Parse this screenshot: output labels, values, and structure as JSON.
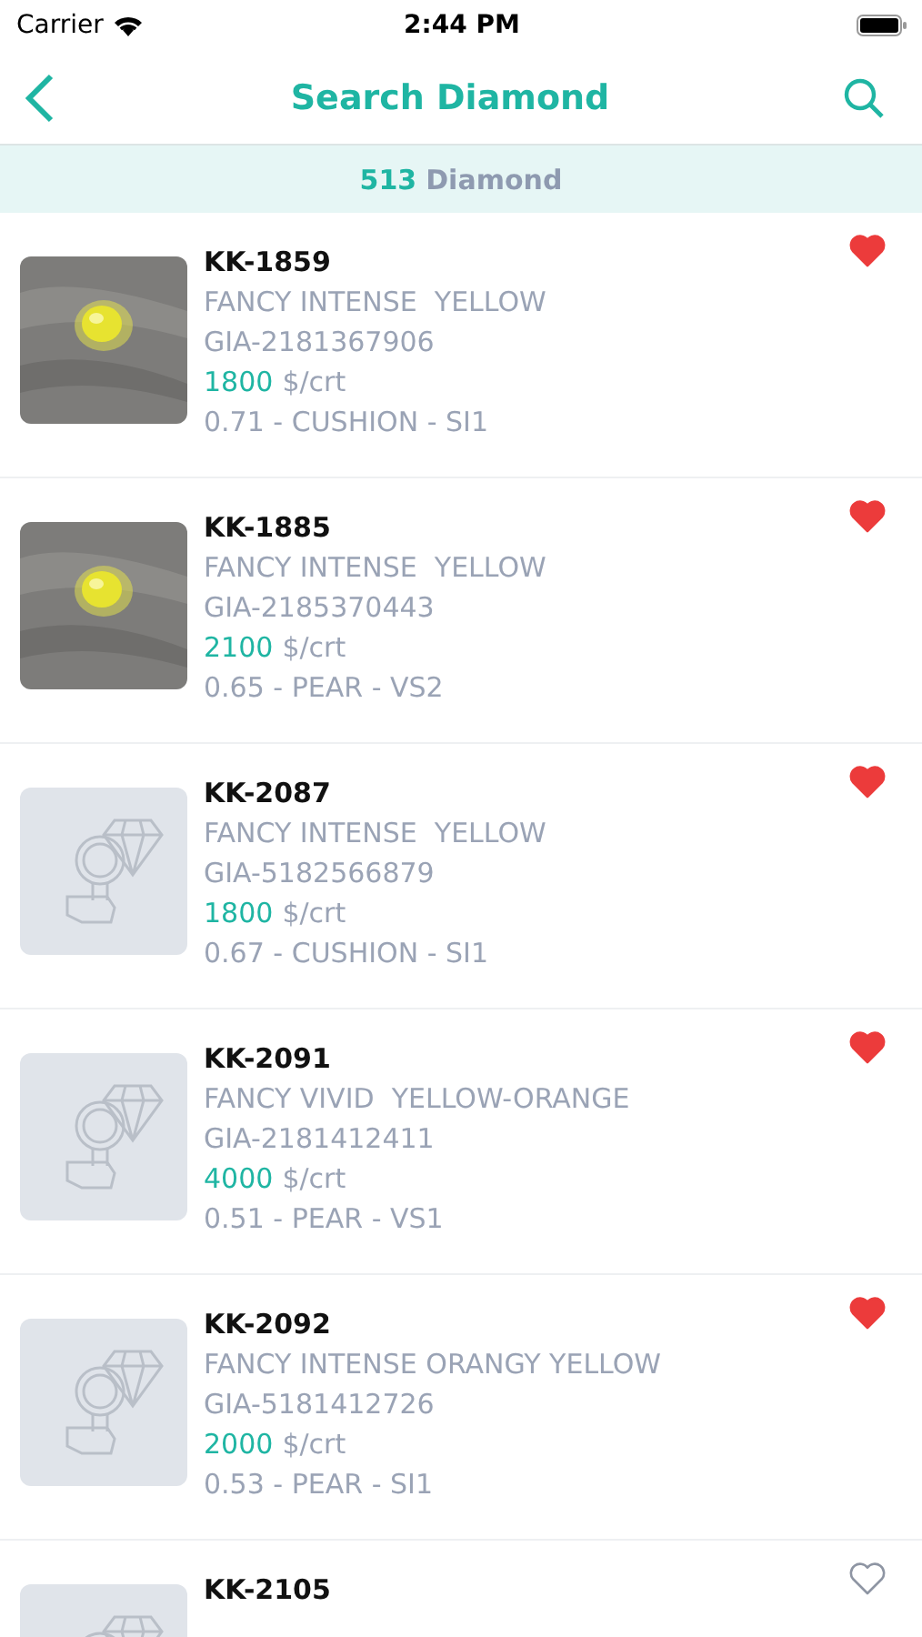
{
  "status_bar": {
    "carrier": "Carrier",
    "time": "2:44 PM"
  },
  "nav": {
    "title": "Search Diamond"
  },
  "count_bar": {
    "count": "513",
    "label": "Diamond"
  },
  "items": [
    {
      "code": "KK-1859",
      "shade": "FANCY INTENSE  YELLOW",
      "cert": "GIA-2181367906",
      "price": "1800",
      "unit": "$/crt",
      "specs": "0.71 - CUSHION - SI1",
      "favorite": true
    },
    {
      "code": "KK-1885",
      "shade": "FANCY INTENSE  YELLOW",
      "cert": "GIA-2185370443",
      "price": "2100",
      "unit": "$/crt",
      "specs": "0.65 - PEAR - VS2",
      "favorite": true
    },
    {
      "code": "KK-2087",
      "shade": "FANCY INTENSE  YELLOW",
      "cert": "GIA-5182566879",
      "price": "1800",
      "unit": "$/crt",
      "specs": "0.67 - CUSHION - SI1",
      "kind": "placeholder",
      "favorite": true
    },
    {
      "code": "KK-2091",
      "shade": "FANCY VIVID  YELLOW-ORANGE",
      "cert": "GIA-2181412411",
      "price": "4000",
      "unit": "$/crt",
      "specs": "0.51 - PEAR - VS1",
      "kind": "placeholder",
      "favorite": true
    },
    {
      "code": "KK-2092",
      "shade": "FANCY INTENSE ORANGY YELLOW",
      "cert": "GIA-5181412726",
      "price": "2000",
      "unit": "$/crt",
      "specs": "0.53 - PEAR - SI1",
      "kind": "placeholder",
      "favorite": true
    },
    {
      "code": "KK-2105",
      "kind": "placeholder",
      "favorite": false
    }
  ]
}
